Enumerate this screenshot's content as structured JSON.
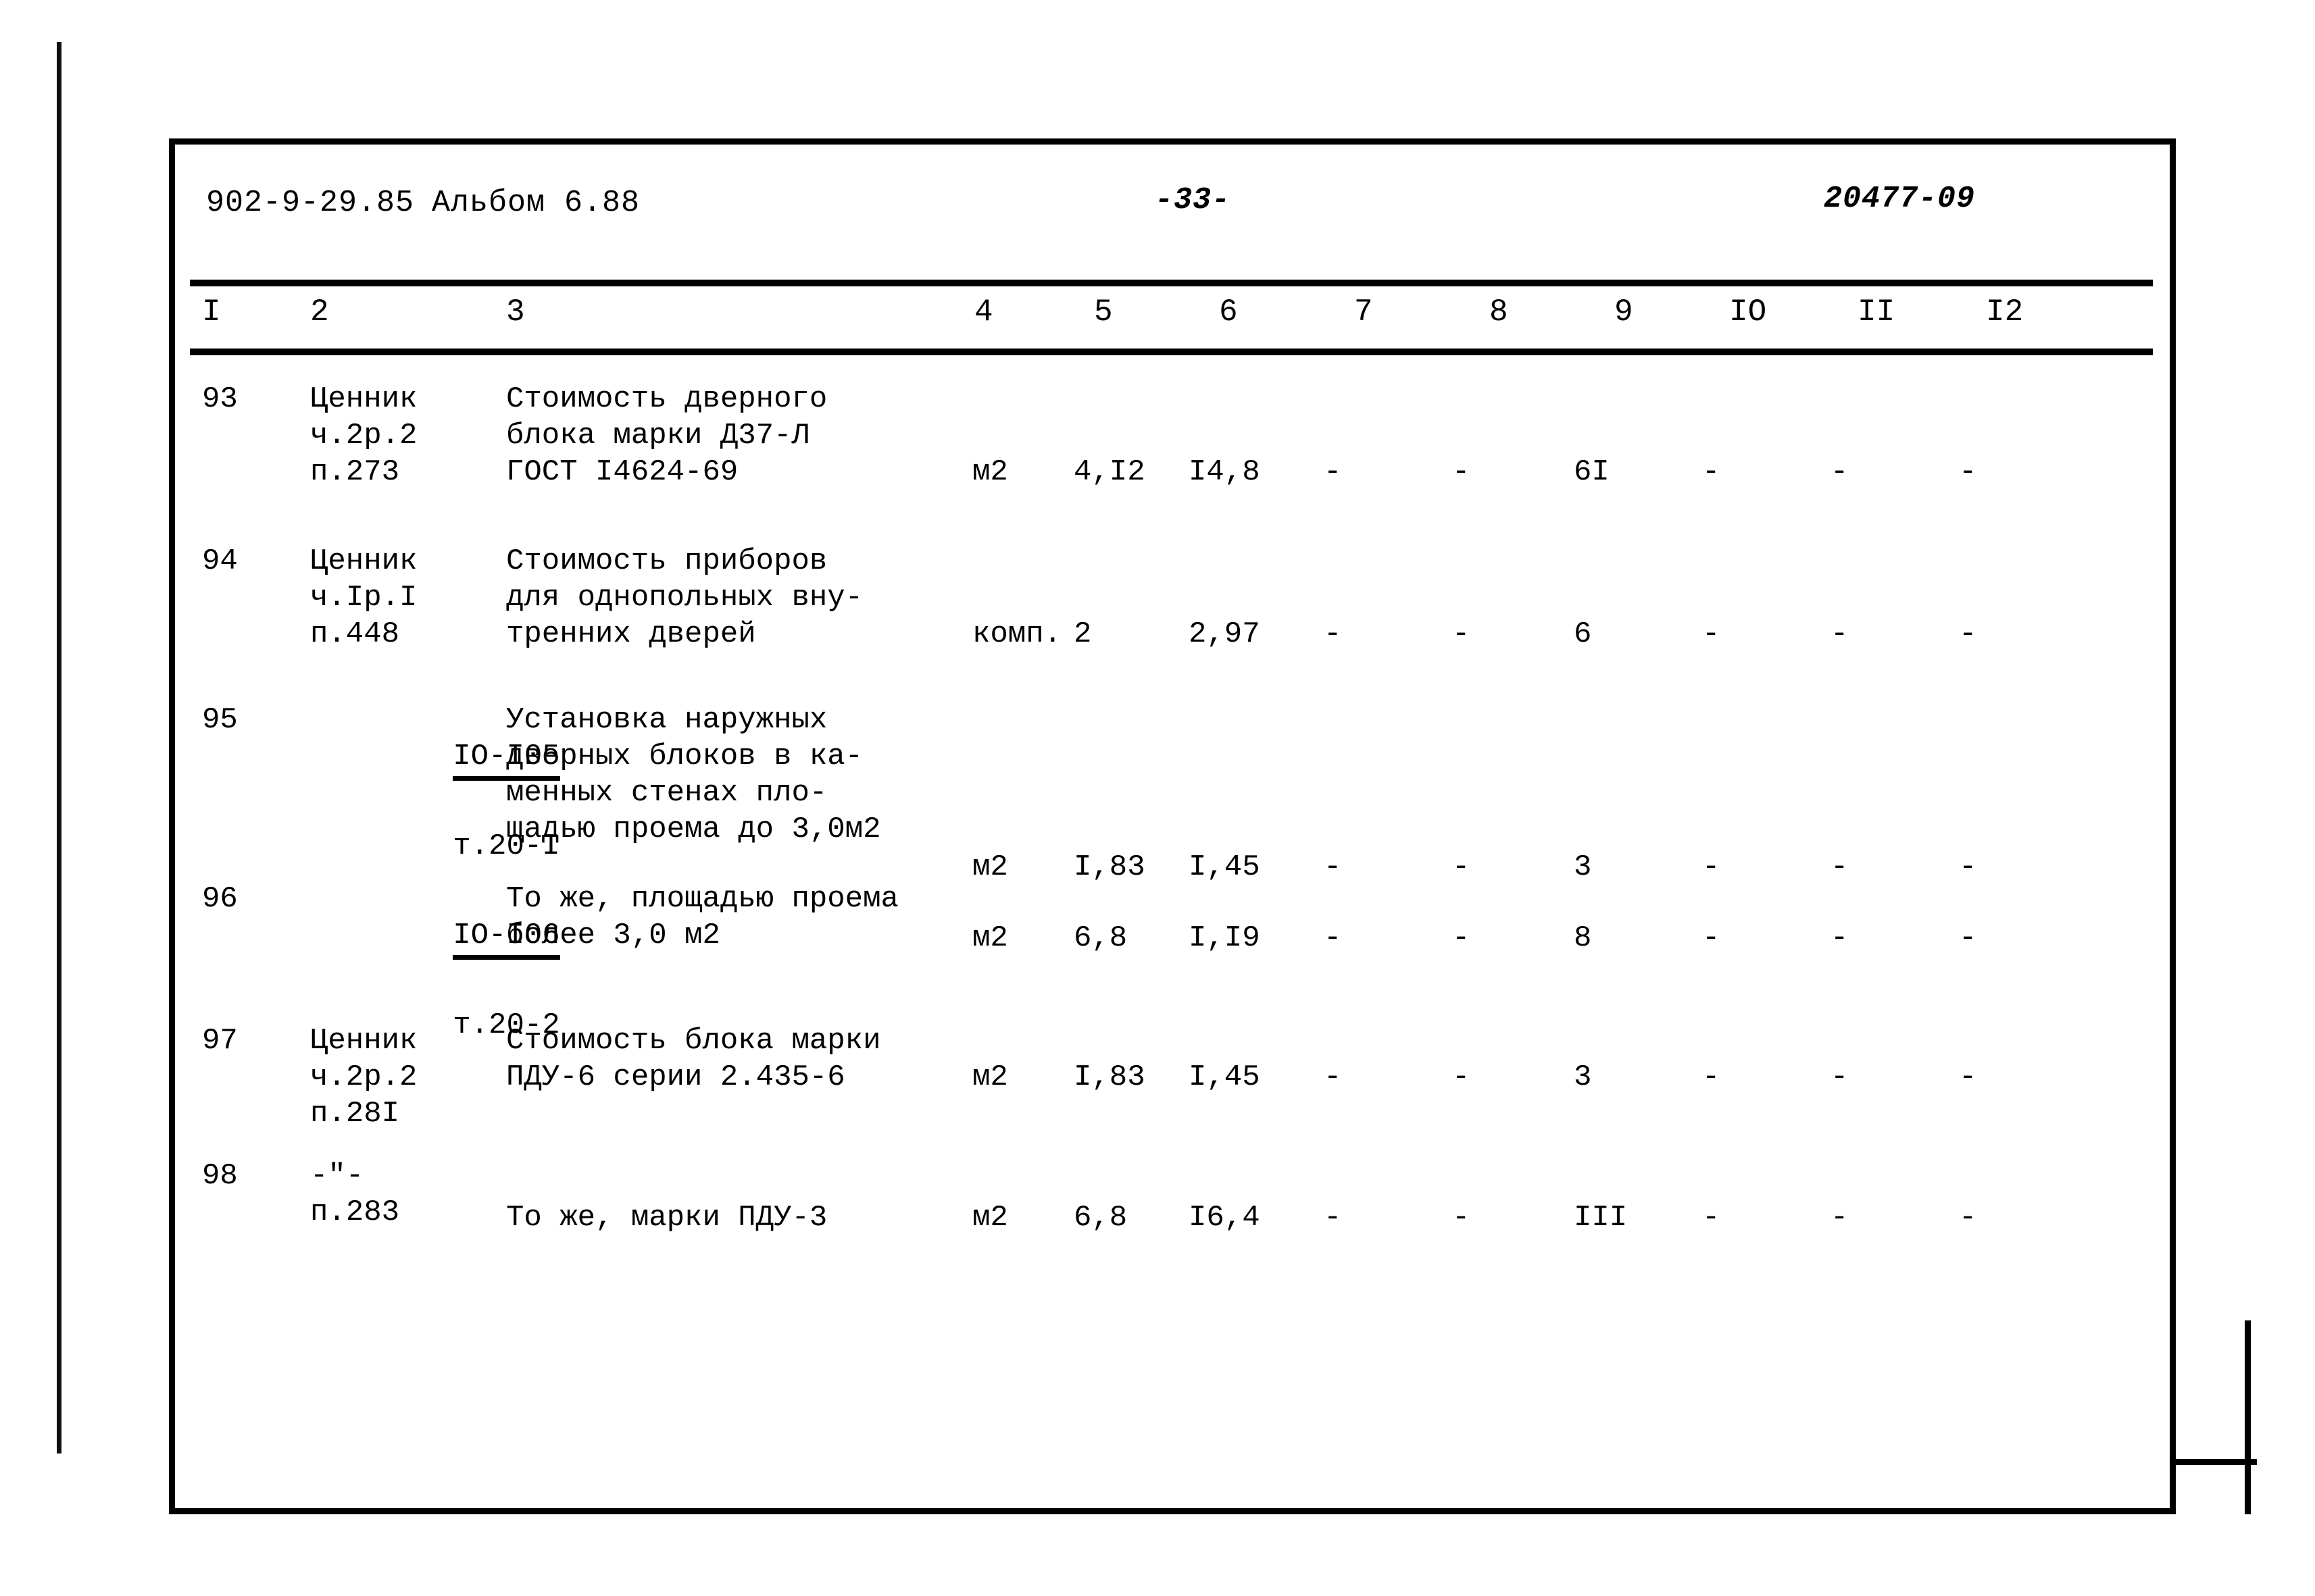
{
  "page": {
    "header": {
      "doc_code": "902-9-29.85",
      "album": "Альбом 6.88",
      "page_number": "-33-",
      "right_code": "20477-09"
    },
    "column_numbers": [
      "I",
      "2",
      "3",
      "4",
      "5",
      "6",
      "7",
      "8",
      "9",
      "IO",
      "II",
      "I2"
    ],
    "rows": [
      {
        "num": "93",
        "code_lines": [
          "Ценник",
          "ч.2р.2",
          "п.273"
        ],
        "code_underline": false,
        "desc_lines": [
          "Стоимость дверного",
          "блока марки Д37-Л",
          "ГОСТ I4624-69"
        ],
        "unit": "м2",
        "v5": "4,I2",
        "v6": "I4,8",
        "v7": "-",
        "v8": "-",
        "v9": "6I",
        "v10": "-",
        "v11": "-",
        "v12": "-"
      },
      {
        "num": "94",
        "code_lines": [
          "Ценник",
          "ч.Iр.I",
          "п.448"
        ],
        "code_underline": false,
        "desc_lines": [
          "Стоимость приборов",
          "для однопольных вну-",
          "тренних дверей"
        ],
        "unit": "комп.",
        "v5": "2",
        "v6": "2,97",
        "v7": "-",
        "v8": "-",
        "v9": "6",
        "v10": "-",
        "v11": "-",
        "v12": "-"
      },
      {
        "num": "95",
        "code_lines": [
          "IO-I05",
          "т.20-I"
        ],
        "code_underline": true,
        "desc_lines": [
          "Установка наружных",
          "дверных блоков в ка-",
          "менных стенах пло-",
          "щадью проема до 3,0м2"
        ],
        "unit": "м2",
        "v5": "I,83",
        "v6": "I,45",
        "v7": "-",
        "v8": "-",
        "v9": "3",
        "v10": "-",
        "v11": "-",
        "v12": "-"
      },
      {
        "num": "96",
        "code_lines": [
          "IO-I06",
          "т.20-2"
        ],
        "code_underline": true,
        "desc_lines": [
          "То же, площадью проема",
          "более 3,0 м2"
        ],
        "unit": "м2",
        "v5": "6,8",
        "v6": "I,I9",
        "v7": "-",
        "v8": "-",
        "v9": "8",
        "v10": "-",
        "v11": "-",
        "v12": "-"
      },
      {
        "num": "97",
        "code_lines": [
          "Ценник",
          "ч.2р.2",
          "п.28I"
        ],
        "code_underline": false,
        "desc_lines": [
          "Стоимость блока марки",
          "ПДУ-6 серии 2.435-6"
        ],
        "unit": "м2",
        "v5": "I,83",
        "v6": "I,45",
        "v7": "-",
        "v8": "-",
        "v9": "3",
        "v10": "-",
        "v11": "-",
        "v12": "-"
      },
      {
        "num": "98",
        "code_lines": [
          "-\"-",
          "п.283"
        ],
        "code_underline": false,
        "desc_lines": [
          "То же, марки ПДУ-3"
        ],
        "unit": "м2",
        "v5": "6,8",
        "v6": "I6,4",
        "v7": "-",
        "v8": "-",
        "v9": "III",
        "v10": "-",
        "v11": "-",
        "v12": "-"
      }
    ]
  }
}
